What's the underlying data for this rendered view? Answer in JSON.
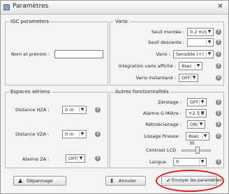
{
  "window": {
    "title": "Paramètres",
    "close_glyph": "✕"
  },
  "igc": {
    "group_title": "IGC parameters",
    "name_label": "Nom et prénom :",
    "name_value": ""
  },
  "vario": {
    "group_title": "Vario",
    "rows": [
      {
        "label": "Seuil montée :",
        "value": "0.2 m/s"
      },
      {
        "label": "Seuil descente :",
        "value": ""
      },
      {
        "label": "Vario :",
        "value": "Sensible (+)"
      },
      {
        "label": "Intégration vario affiché :",
        "value": "8sec"
      },
      {
        "label": "Vario instantané :",
        "value": "OFF"
      }
    ]
  },
  "espaces": {
    "group_title": "Espaces aériens",
    "rows": [
      {
        "label": "Distance HZA :",
        "value": "0 m"
      },
      {
        "label": "Distance VZA :",
        "value": "0 m"
      },
      {
        "label": "Alarme ZA :",
        "value": "OFF"
      }
    ]
  },
  "autres": {
    "group_title": "Autres fonctionnalités",
    "rows": [
      {
        "label": "Zérotage :",
        "value": "OFF"
      },
      {
        "label": "Alarme G Mètre :",
        "value": "+2.5 G"
      },
      {
        "label": "Rétroéclairage :",
        "value": "ON"
      },
      {
        "label": "Lissage finesse :",
        "value": "8sec"
      }
    ],
    "contrast_label": "Contrast LCD",
    "contrast_value": "30",
    "contrast_level_fraction": 0.55,
    "langue_label": "Langue",
    "langue_value": "fr"
  },
  "buttons": {
    "depannage": "Dépannage",
    "annuler": "Annuler",
    "envoyer": "Envoyer les paramètres"
  },
  "help_glyph": "?",
  "arrow_glyph": "▼",
  "colors": {
    "highlight": "#e31b1b"
  }
}
